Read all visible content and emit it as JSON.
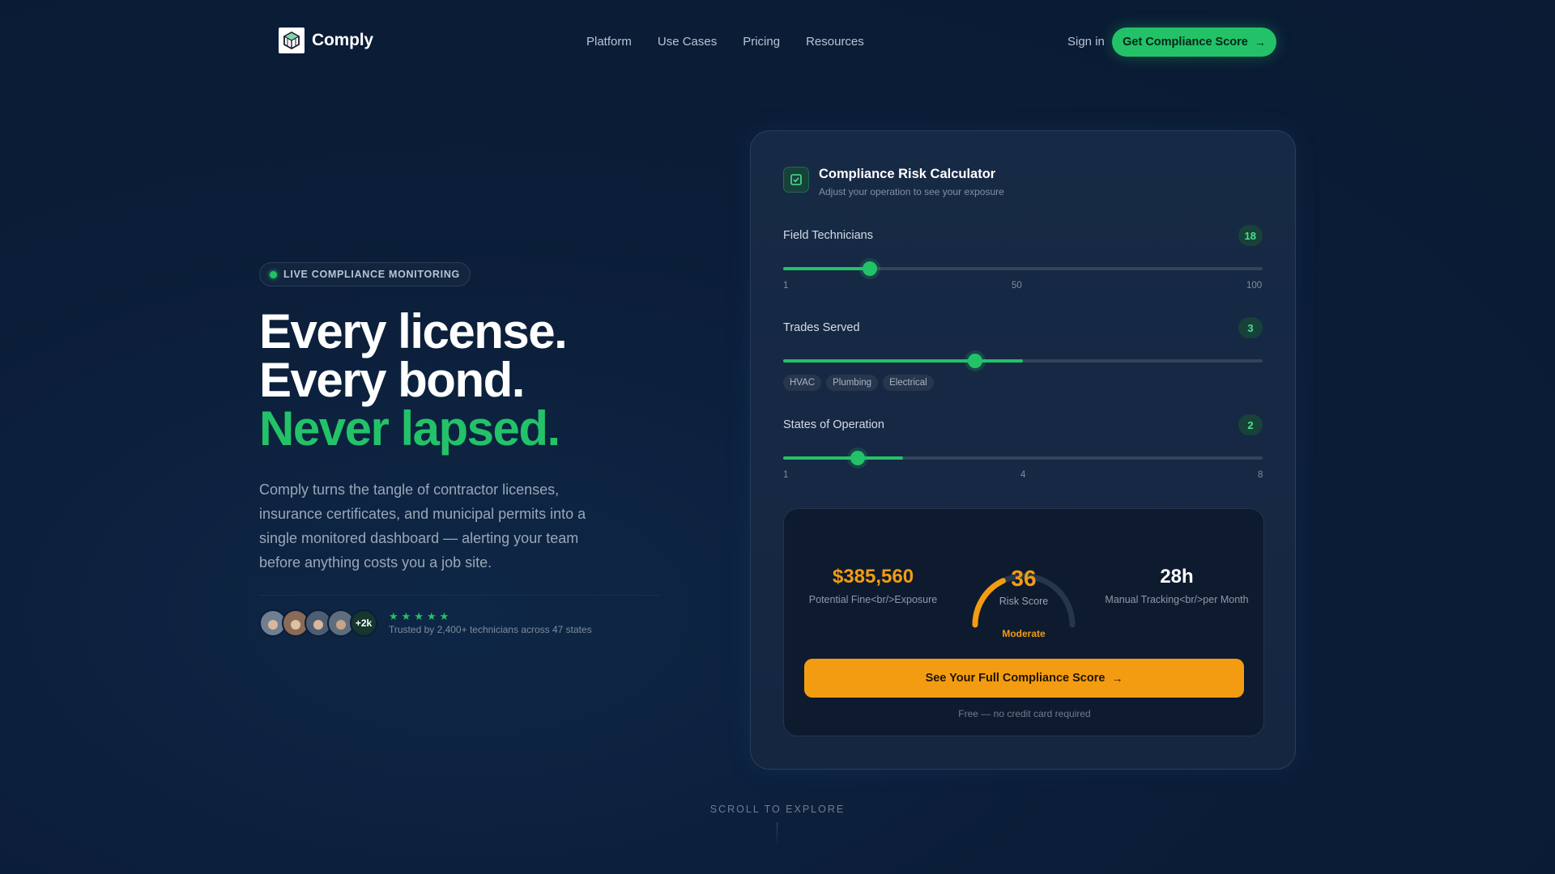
{
  "nav": {
    "brand": "Comply",
    "links": [
      "Platform",
      "Use Cases",
      "Pricing",
      "Resources"
    ],
    "signin": "Sign in",
    "cta": "Get Compliance Score",
    "logo_icon": "cube-logo-icon"
  },
  "hero": {
    "badge": "LIVE COMPLIANCE MONITORING",
    "headline_1": "Every license.",
    "headline_2": "Every bond.",
    "headline_3": "Never lapsed.",
    "subtext": "Comply turns the tangle of contractor licenses, insurance certificates, and municipal permits into a single monitored dashboard — alerting your team before anything costs you a job site.",
    "avatar_more": "+2k",
    "stars": 5,
    "trusted": "Trusted by 2,400+ technicians across 47 states"
  },
  "calculator": {
    "title": "Compliance Risk Calculator",
    "subtitle": "Adjust your operation to see your exposure",
    "technicians": {
      "label": "Field Technicians",
      "value": "18",
      "fraction": 0.18,
      "ticks": [
        "1",
        "50",
        "100"
      ]
    },
    "trades": {
      "label": "Trades Served",
      "value": "3",
      "fraction": 0.4,
      "fill": 0.5,
      "chips": [
        "HVAC",
        "Plumbing",
        "Electrical"
      ]
    },
    "states": {
      "label": "States of Operation",
      "value": "2",
      "fraction": 0.155,
      "fill": 0.25,
      "ticks": [
        "1",
        "4",
        "8"
      ]
    },
    "result": {
      "fine_value": "$385,560",
      "fine_label": "Potential Fine<br/>Exposure",
      "risk_score": "36",
      "risk_label": "Risk Score",
      "risk_fraction": 0.36,
      "risk_level": "Moderate",
      "hours_value": "28h",
      "hours_label": "Manual Tracking<br/>per Month",
      "cta": "See Your Full Compliance Score",
      "note": "Free — no credit card required"
    },
    "colors": {
      "green": "#23c268",
      "orange": "#f39c12"
    }
  },
  "footer": {
    "scroll": "SCROLL TO EXPLORE"
  }
}
